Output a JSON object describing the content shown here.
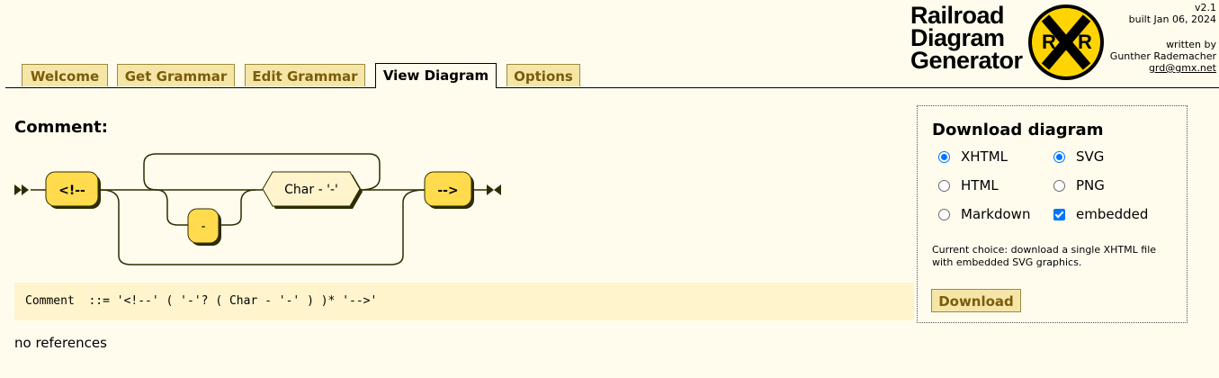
{
  "tabs": [
    "Welcome",
    "Get Grammar",
    "Edit Grammar",
    "View Diagram",
    "Options"
  ],
  "active_tab": "View Diagram",
  "logo": {
    "line1": "Railroad",
    "line2": "Diagram",
    "line3": "Generator",
    "badge_left": "R",
    "badge_right": "R"
  },
  "meta": {
    "version": "v2.1",
    "built": "built Jan 06, 2024",
    "written_by": "written by",
    "author": "Gunther Rademacher",
    "email": "grd@gmx.net"
  },
  "production": {
    "title": "Comment:",
    "diagram": {
      "start_terminal": "<!--",
      "optional_terminal": "-",
      "nonterminal": "Char - '-'",
      "end_terminal": "-->"
    },
    "ebnf": "Comment  ::= '<!--' ( '-'? ( Char - '-' ) )* '-->'",
    "references": "no references"
  },
  "download": {
    "heading": "Download diagram",
    "options": {
      "xhtml": "XHTML",
      "svg": "SVG",
      "html": "HTML",
      "png": "PNG",
      "markdown": "Markdown",
      "embedded": "embedded"
    },
    "selected": {
      "format": "XHTML",
      "graphics": "SVG",
      "embedded": true
    },
    "current_choice": "Current choice: download a single XHTML file with embedded SVG graphics.",
    "button": "Download"
  },
  "colors": {
    "terminal_fill": "#ffdb4d",
    "tab_fill": "#f5e6a8",
    "tab_text": "#7a5c0a",
    "ebnf_bg": "#fff4cc",
    "radio_accent": "#0075ff"
  }
}
